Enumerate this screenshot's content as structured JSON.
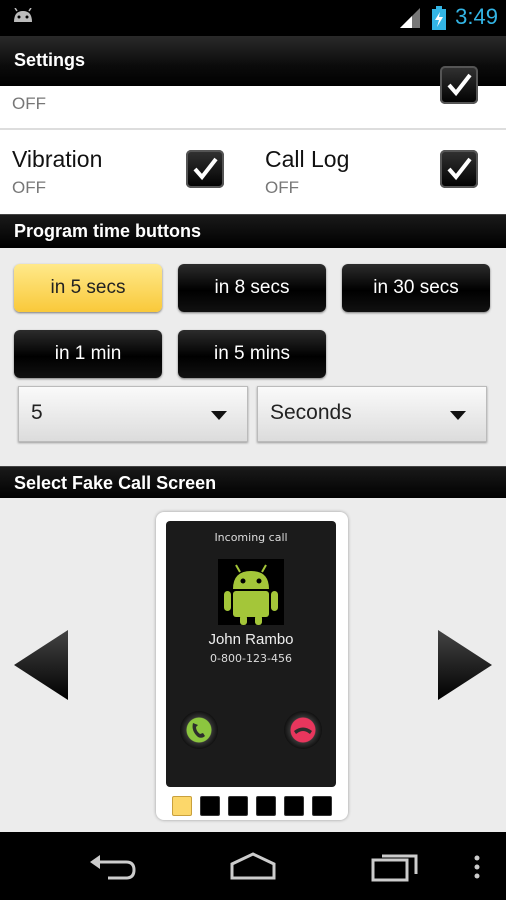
{
  "status_bar": {
    "time": "3:49"
  },
  "app": {
    "title": "Settings"
  },
  "settings": {
    "top_partial": {
      "value": "OFF"
    },
    "vibration": {
      "label": "Vibration",
      "value": "OFF",
      "checked": true
    },
    "call_log": {
      "label": "Call Log",
      "value": "OFF",
      "checked": true
    }
  },
  "program_section": {
    "title": "Program time buttons",
    "buttons": [
      "in 5 secs",
      "in 8 secs",
      "in 30 secs",
      "in 1 min",
      "in 5 mins"
    ],
    "selected_index": 0,
    "amount_spinner": {
      "value": "5"
    },
    "unit_spinner": {
      "value": "Seconds"
    }
  },
  "fake_call_section": {
    "title": "Select Fake Call Screen",
    "preview": {
      "status": "Incoming call",
      "caller_name": "John Rambo",
      "caller_number": "0-800-123-456"
    },
    "page_count": 6,
    "active_page": 0
  },
  "colors": {
    "accent": "#33b5e5",
    "selected_button": "#fcd76a",
    "accept": "#8cc63f",
    "decline": "#e8365d"
  }
}
